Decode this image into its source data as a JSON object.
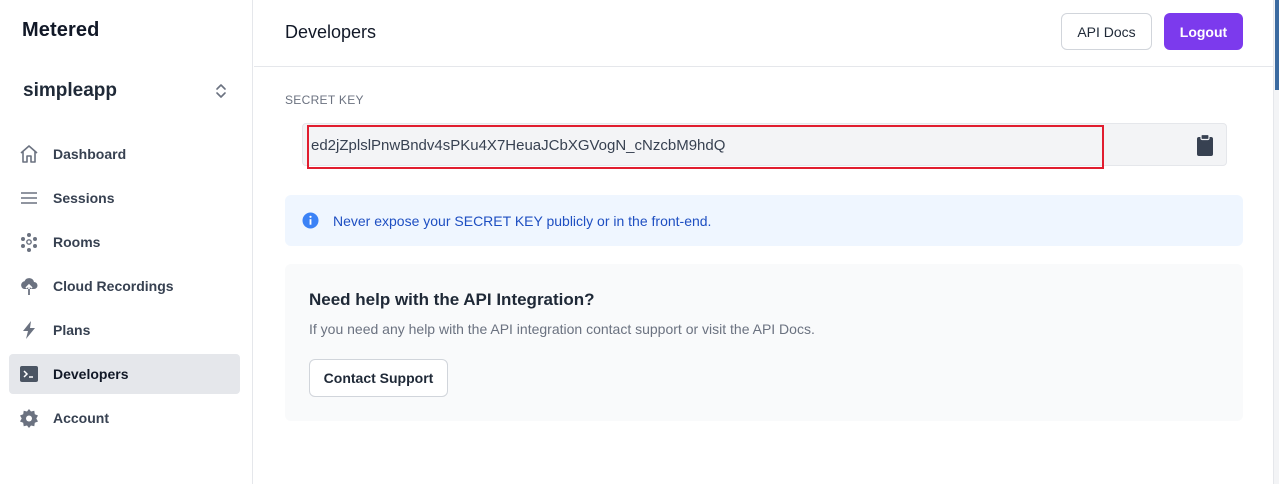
{
  "brand": "Metered",
  "app_switcher": {
    "current": "simpleapp",
    "icon": "chevron-up-down-icon"
  },
  "sidebar": {
    "items": [
      {
        "label": "Dashboard",
        "icon": "home-icon",
        "active": false
      },
      {
        "label": "Sessions",
        "icon": "list-icon",
        "active": false
      },
      {
        "label": "Rooms",
        "icon": "rooms-icon",
        "active": false
      },
      {
        "label": "Cloud Recordings",
        "icon": "cloud-upload-icon",
        "active": false
      },
      {
        "label": "Plans",
        "icon": "bolt-icon",
        "active": false
      },
      {
        "label": "Developers",
        "icon": "terminal-icon",
        "active": true
      },
      {
        "label": "Account",
        "icon": "gear-icon",
        "active": false
      }
    ]
  },
  "header": {
    "title": "Developers",
    "api_docs_label": "API Docs",
    "logout_label": "Logout"
  },
  "secret": {
    "label": "SECRET KEY",
    "value": "ed2jZplslPnwBndv4sPKu4X7HeuaJCbXGVogN_cNzcbM9hdQ",
    "copy_icon": "clipboard-icon"
  },
  "notice": {
    "icon": "info-icon",
    "text": "Never expose your SECRET KEY publicly or in the front-end."
  },
  "help": {
    "title": "Need help with the API Integration?",
    "text": "If you need any help with the API integration contact support or visit the API Docs.",
    "button_label": "Contact Support"
  },
  "colors": {
    "accent": "#7c3aed",
    "info_bg": "#eff6ff",
    "info_text": "#1e4fc2",
    "highlight_border": "#e11d2f"
  }
}
